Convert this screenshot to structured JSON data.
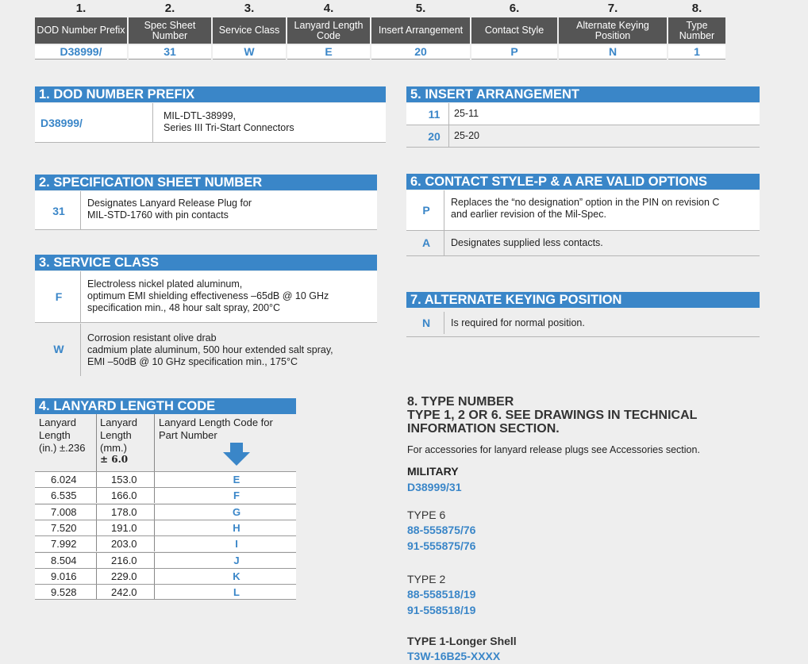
{
  "part_number": {
    "columns": [
      {
        "num": "1.",
        "header": "DOD Number Prefix",
        "value": "D38999/"
      },
      {
        "num": "2.",
        "header": "Spec Sheet Number",
        "value": "31"
      },
      {
        "num": "3.",
        "header": "Service Class",
        "value": "W"
      },
      {
        "num": "4.",
        "header": "Lanyard Length Code",
        "value": "E"
      },
      {
        "num": "5.",
        "header": "Insert Arrangement",
        "value": "20"
      },
      {
        "num": "6.",
        "header": "Contact Style",
        "value": "P"
      },
      {
        "num": "7.",
        "header": "Alternate Keying Position",
        "value": "N"
      },
      {
        "num": "8.",
        "header": "Type Number",
        "value": "1"
      }
    ]
  },
  "sec1": {
    "title": "1. DOD NUMBER PREFIX",
    "code": "D38999/",
    "desc_line1": "MIL-DTL-38999,",
    "desc_line2": "Series III Tri-Start Connectors"
  },
  "sec2": {
    "title": "2. SPECIFICATION SHEET NUMBER",
    "code": "31",
    "desc_line1": "Designates Lanyard Release Plug for",
    "desc_line2": "MIL-STD-1760 with pin contacts"
  },
  "sec3": {
    "title": "3. SERVICE CLASS",
    "rows": [
      {
        "code": "F",
        "l1": "Electroless nickel plated aluminum,",
        "l2": "optimum EMI shielding effectiveness –65dB @ 10 GHz",
        "l3": "specification min., 48 hour salt spray, 200°C"
      },
      {
        "code": "W",
        "l1": "Corrosion resistant olive drab",
        "l2": "cadmium plate aluminum, 500 hour extended salt spray,",
        "l3": "EMI –50dB @ 10 GHz specification min., 175°C"
      }
    ]
  },
  "sec4": {
    "title": "4. LANYARD LENGTH CODE",
    "col1": [
      "Lanyard",
      "Length",
      "(in.) ±.236"
    ],
    "col2": [
      "Lanyard",
      "Length",
      "(mm.)",
      "± 6.0"
    ],
    "col3": [
      "Lanyard Length Code for",
      "Part Number"
    ],
    "rows": [
      {
        "in": "6.024",
        "mm": "153.0",
        "code": "E"
      },
      {
        "in": "6.535",
        "mm": "166.0",
        "code": "F"
      },
      {
        "in": "7.008",
        "mm": "178.0",
        "code": "G"
      },
      {
        "in": "7.520",
        "mm": "191.0",
        "code": "H"
      },
      {
        "in": "7.992",
        "mm": "203.0",
        "code": "I"
      },
      {
        "in": "8.504",
        "mm": "216.0",
        "code": "J"
      },
      {
        "in": "9.016",
        "mm": "229.0",
        "code": "K"
      },
      {
        "in": "9.528",
        "mm": "242.0",
        "code": "L"
      }
    ]
  },
  "sec5": {
    "title": "5. INSERT ARRANGEMENT",
    "rows": [
      {
        "code": "11",
        "desc": "25-11"
      },
      {
        "code": "20",
        "desc": "25-20"
      }
    ]
  },
  "sec6": {
    "title": "6. CONTACT STYLE-P & A ARE VALID OPTIONS",
    "rows": [
      {
        "code": "P",
        "l1": "Replaces the “no designation” option in the PIN on revision C",
        "l2": "and earlier revision of the Mil-Spec."
      },
      {
        "code": "A",
        "l1": "Designates supplied less contacts.",
        "l2": ""
      }
    ]
  },
  "sec7": {
    "title": "7. ALTERNATE KEYING POSITION",
    "code": "N",
    "desc": "Is required for normal position."
  },
  "sec8": {
    "line1": "8. TYPE NUMBER",
    "line2": "TYPE 1, 2 OR 6. SEE DRAWINGS IN TECHNICAL",
    "line3": "INFORMATION SECTION.",
    "note": "For accessories for lanyard release plugs see Accessories section.",
    "military_label": "MILITARY",
    "military_pn": "D38999/31",
    "type6_label": "TYPE 6",
    "type6_pn1": "88-555875/76",
    "type6_pn2": "91-555875/76",
    "type2_label": "TYPE 2",
    "type2_pn1": "88-558518/19",
    "type2_pn2": "91-558518/19",
    "type1_label": "TYPE 1-Longer Shell",
    "type1_pn": "T3W-16B25-XXXX"
  },
  "colors": {
    "accent": "#3a86c8",
    "header_grey": "#555555",
    "background": "#eeeeee"
  }
}
